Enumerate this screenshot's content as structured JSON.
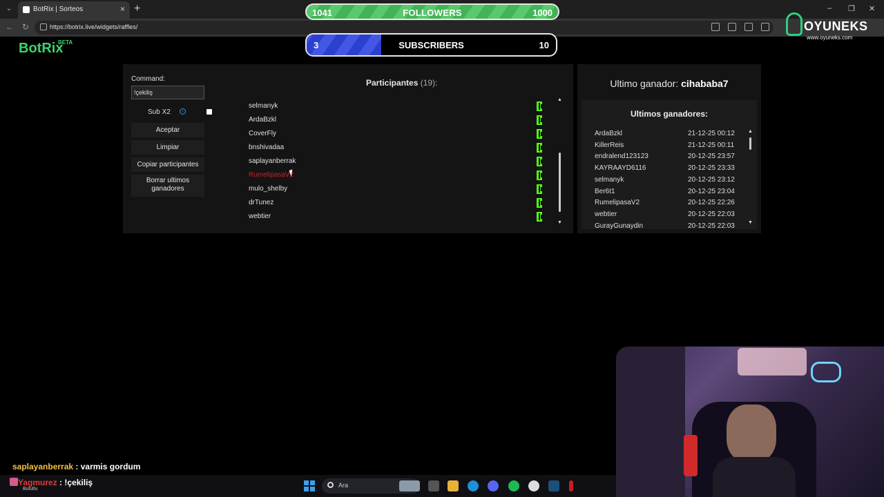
{
  "browser": {
    "tab_title": "BotRix | Sorteos",
    "url": "https://botrix.live/widgets/raffles/"
  },
  "app": {
    "logo": "BotRix",
    "logo_badge": "BETA"
  },
  "overlay": {
    "followers": {
      "current": "1041",
      "label": "FOLLOWERS",
      "goal": "1000",
      "progress": 1.0
    },
    "subscribers": {
      "current": "3",
      "label": "SUBSCRIBERS",
      "goal": "10",
      "progress": 0.3
    },
    "brand_name": "OYUNEKS",
    "brand_url": "www.oyuneks.com"
  },
  "raffle": {
    "command_label": "Command:",
    "command_value": "!çekiliş",
    "sub_x2_label": "Sub X2",
    "buttons": {
      "accept": "Aceptar",
      "clear": "Limpiar",
      "copy": "Copiar participantes",
      "clear_winners": "Borrar ultimos ganadores"
    },
    "participants_title": "Participantes",
    "participants_count": "(19):",
    "participants": [
      {
        "name": "selmanyk",
        "highlight": false
      },
      {
        "name": "ArdaBzkl",
        "highlight": false
      },
      {
        "name": "CoverFly",
        "highlight": false
      },
      {
        "name": "bnshivadaa",
        "highlight": false
      },
      {
        "name": "saplayanberrak",
        "highlight": false
      },
      {
        "name": "RumelipasaV2",
        "highlight": true
      },
      {
        "name": "mulo_shelby",
        "highlight": false
      },
      {
        "name": "drTunez",
        "highlight": false
      },
      {
        "name": "webtier",
        "highlight": false
      }
    ]
  },
  "winners": {
    "last_winner_label": "Ultimo ganador:",
    "last_winner_name": "cihababa7",
    "title": "Ultimos ganadores:",
    "list": [
      {
        "name": "ArdaBzkl",
        "date": "21-12-25 00:12"
      },
      {
        "name": "KillerReis",
        "date": "21-12-25 00:11"
      },
      {
        "name": "endralend123123",
        "date": "20-12-25 23:57"
      },
      {
        "name": "KAYRAAYD6116",
        "date": "20-12-25 23:33"
      },
      {
        "name": "selmanyk",
        "date": "20-12-25 23:12"
      },
      {
        "name": "Ber6t1",
        "date": "20-12-25 23:04"
      },
      {
        "name": "RumelipasaV2",
        "date": "20-12-25 22:26"
      },
      {
        "name": "webtier",
        "date": "20-12-25 22:03"
      },
      {
        "name": "GurayGunaydin",
        "date": "20-12-25 22:03"
      }
    ]
  },
  "chat": [
    {
      "user": "saplayanberrak",
      "message": ": varmis gordum"
    },
    {
      "user": "Yagmurez",
      "message": ": !çekiliş",
      "sub": "Bulutlu"
    }
  ],
  "taskbar": {
    "search_placeholder": "Ara"
  },
  "colors": {
    "accent_green": "#3bd46b",
    "kick_green": "#53fc18",
    "highlight_red": "#c8232b",
    "followers_bar": "#41b456",
    "subscribers_bar": "#2b3fd1"
  }
}
